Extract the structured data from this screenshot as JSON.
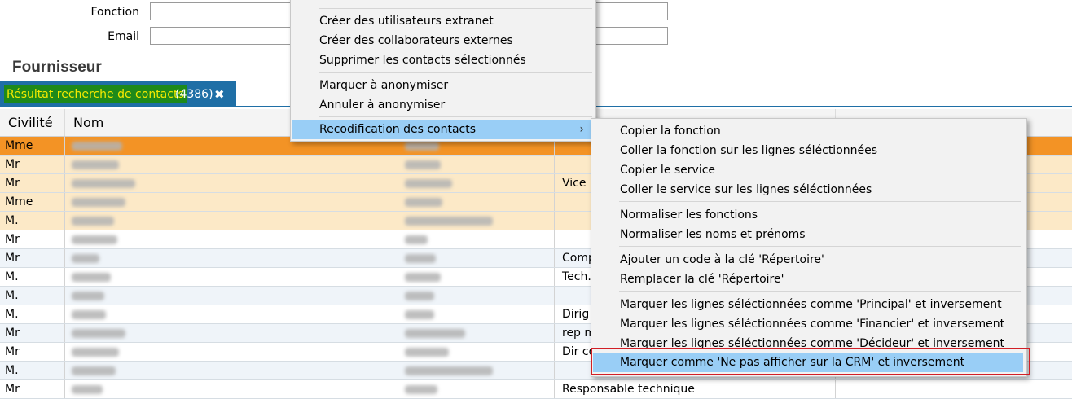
{
  "form": {
    "fonction_label": "Fonction",
    "email_label": "Email",
    "fonction_value": "",
    "email_value": "",
    "section_title": "Fournisseur"
  },
  "tab": {
    "label": "Résultat recherche de contacts",
    "count": "(4386)",
    "close": "✖"
  },
  "grid": {
    "columns": [
      "Civilité",
      "Nom",
      "",
      "",
      ""
    ],
    "rows": [
      {
        "civilite": "Mme",
        "fonction": "",
        "state": "selected"
      },
      {
        "civilite": "Mr",
        "fonction": "",
        "state": "highlight"
      },
      {
        "civilite": "Mr",
        "fonction": "Vice P",
        "state": "highlight"
      },
      {
        "civilite": "Mme",
        "fonction": "",
        "state": "highlight"
      },
      {
        "civilite": "M.",
        "fonction": "",
        "state": "highlight"
      },
      {
        "civilite": "Mr",
        "fonction": "",
        "state": "normal"
      },
      {
        "civilite": "Mr",
        "fonction": "Comp",
        "state": "alt"
      },
      {
        "civilite": "M.",
        "fonction": "Tech.",
        "state": "normal"
      },
      {
        "civilite": "M.",
        "fonction": "",
        "state": "alt"
      },
      {
        "civilite": "M.",
        "fonction": "Dirig",
        "state": "normal"
      },
      {
        "civilite": "Mr",
        "fonction": "rep m",
        "state": "alt"
      },
      {
        "civilite": "Mr",
        "fonction": "Dir co",
        "state": "normal"
      },
      {
        "civilite": "M.",
        "fonction": "",
        "state": "alt"
      },
      {
        "civilite": "Mr",
        "fonction": "Responsable technique",
        "state": "normal"
      }
    ]
  },
  "menu_main": {
    "items": [
      "Créer des utilisateurs extranet",
      "Créer des collaborateurs externes",
      "Supprimer les contacts sélectionnés",
      "Marquer à anonymiser",
      "Annuler à anonymiser",
      "Recodification des contacts"
    ],
    "submenu_arrow": "›"
  },
  "menu_sub": {
    "items": [
      "Copier la fonction",
      "Coller la fonction sur les lignes séléctionnées",
      "Copier le service",
      "Coller le service sur les lignes séléctionnées",
      "Normaliser les fonctions",
      "Normaliser les noms et prénoms",
      "Ajouter un code à la clé 'Répertoire'",
      "Remplacer la clé 'Répertoire'",
      "Marquer les lignes séléctionnées comme 'Principal' et inversement",
      "Marquer les lignes séléctionnées comme 'Financier' et inversement",
      "Marquer les lignes séléctionnées comme 'Décideur' et inversement",
      "Marquer comme 'Ne pas afficher sur la CRM' et inversement"
    ]
  },
  "colors": {
    "tab_bg": "#1f6fa6",
    "tab_highlight_bg": "#1e8a1a",
    "tab_highlight_text": "#f5ea00",
    "selected_row": "#f39325",
    "highlight_row": "#fce9c7",
    "menu_active": "#99cef6",
    "annotation_red": "#d21f26"
  }
}
